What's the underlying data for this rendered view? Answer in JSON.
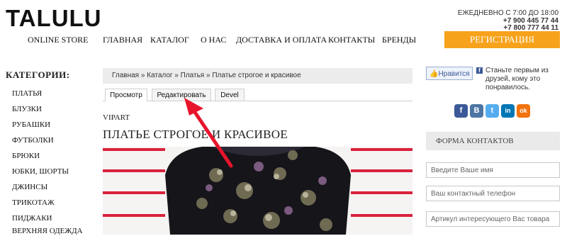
{
  "header": {
    "logo": "TALULU",
    "tagline": "ONLINE STORE",
    "nav": [
      "ГЛАВНАЯ",
      "КАТАЛОГ",
      "О НАС",
      "ДОСТАВКА И ОПЛАТА",
      "КОНТАКТЫ",
      "БРЕНДЫ"
    ],
    "hours": "ЕЖЕДНЕВНО С 7:00 ДО 18:00",
    "phones": [
      "+7 900 445 77 44",
      "+7 800 777 44 11"
    ],
    "register_label": "РЕГИСТРАЦИЯ"
  },
  "sidebar": {
    "title": "КАТЕГОРИИ:",
    "items": [
      "ПЛАТЬЯ",
      "БЛУЗКИ",
      "РУБАШКИ",
      "ФУТБОЛКИ",
      "БРЮКИ",
      "ЮБКИ, ШОРТЫ",
      "ДЖИНСЫ",
      "ТРИКОТАЖ",
      "ПИДЖАКИ",
      "ВЕРХНЯЯ ОДЕЖДА"
    ]
  },
  "main": {
    "breadcrumb": "Главная » Каталог » Платья » Платье строгое и красивое",
    "tabs": [
      "Просмотр",
      "Редактировать",
      "Devel"
    ],
    "vendor": "VIPART",
    "product_title": "ПЛАТЬЕ СТРОГОЕ И КРАСИВОЕ"
  },
  "social": {
    "like_label": "Нравится",
    "like_text": "Станьте первым из друзей, кому это понравилось.",
    "icons": [
      {
        "name": "facebook",
        "glyph": "f",
        "color": "#3b5998"
      },
      {
        "name": "vkontakte",
        "glyph": "B",
        "color": "#4c75a3"
      },
      {
        "name": "twitter",
        "glyph": "t",
        "color": "#55acee"
      },
      {
        "name": "linkedin",
        "glyph": "in",
        "color": "#0077b5"
      },
      {
        "name": "odnoklassniki",
        "glyph": "ok",
        "color": "#f2720c"
      }
    ]
  },
  "contact_form": {
    "title": "ФОРМА КОНТАКТОВ",
    "name_placeholder": "Введите Ваше имя",
    "phone_placeholder": "Ваш контактный телефон",
    "article_placeholder": "Артикул интересующего Вас товара"
  },
  "colors": {
    "accent": "#f7a21b",
    "annotation_arrow": "#e8142c"
  }
}
